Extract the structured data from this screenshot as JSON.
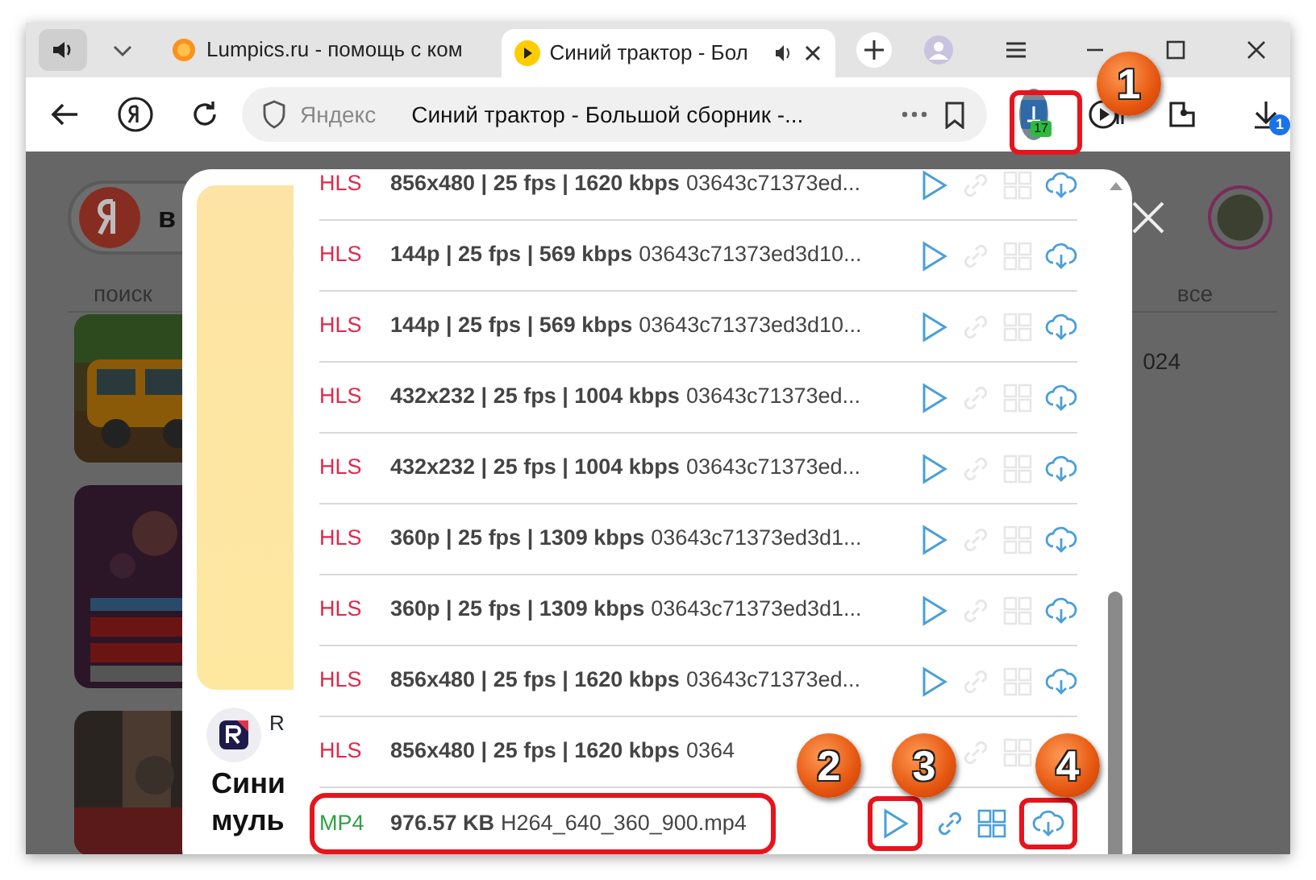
{
  "tabs": [
    {
      "title": "Lumpics.ru - помощь с ком",
      "kind": "site",
      "selected": false
    },
    {
      "title": "Синий трактор - Бол",
      "kind": "video",
      "selected": true
    }
  ],
  "address_bar": {
    "site": "Яндекс",
    "title": "Синий трактор - Большой сборник -..."
  },
  "extension_badge": "17",
  "downloads_badge": "1",
  "page": {
    "search_text": "в",
    "filters": [
      "поиск",
      "все"
    ],
    "date_fragment": "024",
    "channel_initial": "R",
    "title_lines": [
      "Сини",
      "муль"
    ]
  },
  "media_list": [
    {
      "format": "HLS",
      "kind": "hls",
      "spec": "856x480 | 25 fps | 1620 kbps",
      "name": "03643c71373ed...",
      "highlighted": false
    },
    {
      "format": "HLS",
      "kind": "hls",
      "spec": "144p | 25 fps | 569 kbps",
      "name": "03643c71373ed3d10...",
      "highlighted": false
    },
    {
      "format": "HLS",
      "kind": "hls",
      "spec": "144p | 25 fps | 569 kbps",
      "name": "03643c71373ed3d10...",
      "highlighted": false
    },
    {
      "format": "HLS",
      "kind": "hls",
      "spec": "432x232 | 25 fps | 1004 kbps",
      "name": "03643c71373ed...",
      "highlighted": false
    },
    {
      "format": "HLS",
      "kind": "hls",
      "spec": "432x232 | 25 fps | 1004 kbps",
      "name": "03643c71373ed...",
      "highlighted": false
    },
    {
      "format": "HLS",
      "kind": "hls",
      "spec": "360p | 25 fps | 1309 kbps",
      "name": "03643c71373ed3d1...",
      "highlighted": false
    },
    {
      "format": "HLS",
      "kind": "hls",
      "spec": "360p | 25 fps | 1309 kbps",
      "name": "03643c71373ed3d1...",
      "highlighted": false
    },
    {
      "format": "HLS",
      "kind": "hls",
      "spec": "856x480 | 25 fps | 1620 kbps",
      "name": "03643c71373ed...",
      "highlighted": false
    },
    {
      "format": "HLS",
      "kind": "hls",
      "spec": "856x480 | 25 fps | 1620 kbps",
      "name": "0364",
      "highlighted": false
    },
    {
      "format": "MP4",
      "kind": "mp4",
      "spec": "976.57 KB",
      "name": "H264_640_360_900.mp4",
      "highlighted": true
    }
  ],
  "callouts": [
    "1",
    "2",
    "3",
    "4"
  ]
}
